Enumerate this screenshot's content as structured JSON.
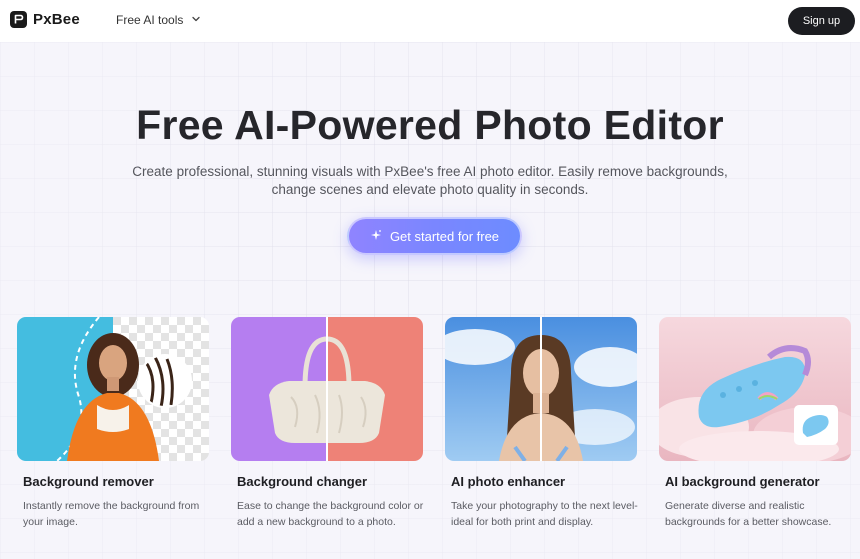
{
  "header": {
    "logo_text": "PxBee",
    "nav_tools_label": "Free AI tools",
    "signup_label": "Sign up"
  },
  "hero": {
    "title": "Free AI-Powered Photo Editor",
    "subtitle": "Create professional, stunning visuals with PxBee's free AI photo editor. Easily remove backgrounds, change scenes and elevate photo quality in seconds.",
    "cta_label": "Get started for free"
  },
  "cards": [
    {
      "title": "Background remover",
      "description": "Instantly remove the background from your image.",
      "image": "woman-orange-jacket-cutout"
    },
    {
      "title": "Background changer",
      "description": "Ease to change the background color or add a new background to a photo.",
      "image": "white-handbag-split-background"
    },
    {
      "title": "AI photo enhancer",
      "description": "Take your photography to the next level-ideal for both print and display.",
      "image": "woman-sky-before-after"
    },
    {
      "title": "AI background generator",
      "description": "Generate diverse and realistic backgrounds for a better showcase.",
      "image": "blue-clog-clouds"
    }
  ],
  "colors": {
    "accent_start": "#8f84ff",
    "accent_end": "#6d8cff",
    "signup_bg": "#1c1d21",
    "hero_bg": "#f6f5fb"
  },
  "icons": [
    "pxbee-logo-icon",
    "chevron-down-icon",
    "sparkle-icon"
  ]
}
